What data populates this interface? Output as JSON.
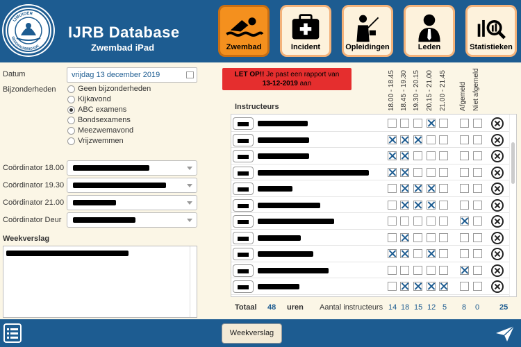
{
  "header": {
    "title": "IJRB Database",
    "subtitle": "Zwembad iPad",
    "logo_text": "IJMUIDER REDDINGSBRIGADE"
  },
  "tabs": [
    {
      "label": "Zwembad",
      "icon": "swimmer-icon",
      "active": true
    },
    {
      "label": "Incident",
      "icon": "first-aid-kit-icon",
      "active": false
    },
    {
      "label": "Opleidingen",
      "icon": "teacher-icon",
      "active": false
    },
    {
      "label": "Leden",
      "icon": "person-icon",
      "active": false
    },
    {
      "label": "Statistieken",
      "icon": "chart-magnifier-icon",
      "active": false
    }
  ],
  "form": {
    "datum_label": "Datum",
    "datum_value": "vrijdag 13 december 2019",
    "bijzonderheden_label": "Bijzonderheden",
    "options": [
      {
        "label": "Geen bijzonderheden",
        "selected": false
      },
      {
        "label": "Kijkavond",
        "selected": false
      },
      {
        "label": "ABC examens",
        "selected": true
      },
      {
        "label": "Bondsexamens",
        "selected": false
      },
      {
        "label": "Meezwemavond",
        "selected": false
      },
      {
        "label": "Vrijzwemmen",
        "selected": false
      }
    ],
    "coordinators": [
      {
        "label": "Coördinator 18.00"
      },
      {
        "label": "Coördinator 19.30"
      },
      {
        "label": "Coördinator 21.00"
      },
      {
        "label": "Coördinator Deur"
      }
    ],
    "weekverslag_label": "Weekverslag"
  },
  "alert": {
    "bold": "LET OP!!",
    "text": " Je past een rapport van",
    "date": "13-12-2019",
    "suffix": " aan"
  },
  "columns": [
    "18.00 - 18.45",
    "18.45 - 19.30",
    "19.30 - 20.15",
    "20.15 - 21.00",
    "21.00 - 21.45",
    "Afgemeld",
    "Niet afgemeld"
  ],
  "instructeurs_label": "Instructeurs",
  "rows": [
    [
      false,
      false,
      false,
      true,
      false,
      false,
      false
    ],
    [
      true,
      true,
      true,
      false,
      false,
      false,
      false
    ],
    [
      true,
      true,
      false,
      false,
      false,
      false,
      false
    ],
    [
      true,
      true,
      false,
      false,
      false,
      false,
      false
    ],
    [
      false,
      true,
      true,
      true,
      false,
      false,
      false
    ],
    [
      false,
      true,
      true,
      true,
      false,
      false,
      false
    ],
    [
      false,
      false,
      false,
      false,
      false,
      true,
      false
    ],
    [
      false,
      true,
      false,
      false,
      false,
      false,
      false
    ],
    [
      true,
      true,
      false,
      true,
      false,
      false,
      false
    ],
    [
      false,
      false,
      false,
      false,
      false,
      true,
      false
    ],
    [
      false,
      true,
      true,
      true,
      true,
      false,
      false
    ]
  ],
  "totals": {
    "label": "Totaal",
    "hours": "48",
    "hours_unit": "uren",
    "count_label": "Aantal instructeurs",
    "col_counts": [
      "14",
      "18",
      "15",
      "12",
      "5"
    ],
    "afgemeld": "8",
    "niet_afgemeld": "0",
    "total": "25"
  },
  "footer": {
    "weekverslag_button": "Weekverslag"
  },
  "colors": {
    "header": "#1d5c91",
    "active_tab": "#f4901e",
    "alert": "#e52e2e",
    "background": "#fbf6e6"
  }
}
